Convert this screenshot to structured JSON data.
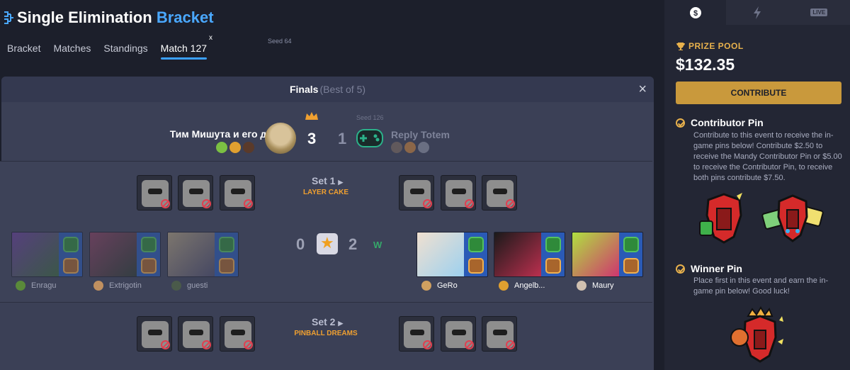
{
  "header": {
    "title_main": "Single Elimination",
    "title_accent": "Bracket"
  },
  "tabs": [
    {
      "label": "Bracket"
    },
    {
      "label": "Matches"
    },
    {
      "label": "Standings"
    },
    {
      "label": "Match 127",
      "close": "x"
    }
  ],
  "match": {
    "round": "Finals",
    "best_of": "(Best of 5)",
    "close_icon": "×",
    "team_a": {
      "name": "Тим Мишута и его друзья",
      "seed": "Seed 64",
      "score": "3"
    },
    "team_b": {
      "name": "Reply Totem",
      "seed": "Seed 126",
      "score": "1"
    },
    "sets": [
      {
        "title": "Set 1",
        "map": "LAYER CAKE",
        "score_a": "0",
        "score_b": "2",
        "winner_mark": "W",
        "players_a": [
          "Enragu",
          "Extrigotin",
          "guesti"
        ],
        "players_b": [
          "GeRo",
          "Angelb...",
          "Maury"
        ]
      },
      {
        "title": "Set 2",
        "map": "PINBALL DREAMS"
      }
    ]
  },
  "sidebar": {
    "tabs": [
      {
        "icon": "dollar-icon"
      },
      {
        "icon": "lightning-icon"
      },
      {
        "label": "LIVE"
      }
    ],
    "prize_label": "PRIZE POOL",
    "prize_amount": "$132.35",
    "contribute_label": "CONTRIBUTE",
    "contributor_pin": {
      "title": "Contributor Pin",
      "text": "Contribute to this event to receive the in-game pins below! Contribute $2.50 to receive the Mandy Contributor Pin or $5.00 to receive the Contributor Pin, to receive both pins contribute $7.50."
    },
    "winner_pin": {
      "title": "Winner Pin",
      "text": "Place first in this event and earn the in-game pin below! Good luck!"
    }
  },
  "colors": {
    "accent": "#4aa8ff",
    "gold": "#c9993c",
    "win": "#35a86a",
    "ban": "#e04050"
  }
}
